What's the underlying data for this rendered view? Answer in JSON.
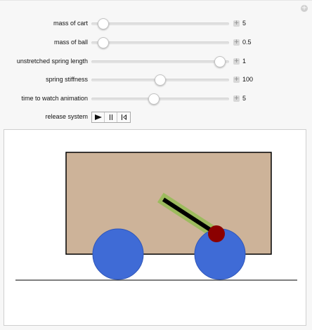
{
  "colors": {
    "cart_body": "#CDB399",
    "wheel": "#3F6BD6",
    "spring_tube": "#9DBB5E",
    "spring_rod": "#000000",
    "ball": "#8B0000",
    "ground": "#333333",
    "panel_background": "#F7F7F7"
  },
  "icons": {
    "corner": "plus-icon",
    "stepper": "plus-icon",
    "play": "play-icon",
    "pause": "pause-icon",
    "reset": "reset-icon"
  },
  "controls": {
    "sliders": [
      {
        "label": "mass of cart",
        "value": "5",
        "position_fraction": 0.05
      },
      {
        "label": "mass of ball",
        "value": "0.5",
        "position_fraction": 0.05
      },
      {
        "label": "unstretched spring length",
        "value": "1",
        "position_fraction": 0.97
      },
      {
        "label": "spring stiffness",
        "value": "100",
        "position_fraction": 0.5
      },
      {
        "label": "time to watch animation",
        "value": "5",
        "position_fraction": 0.45
      }
    ],
    "release": {
      "label": "release system"
    }
  }
}
